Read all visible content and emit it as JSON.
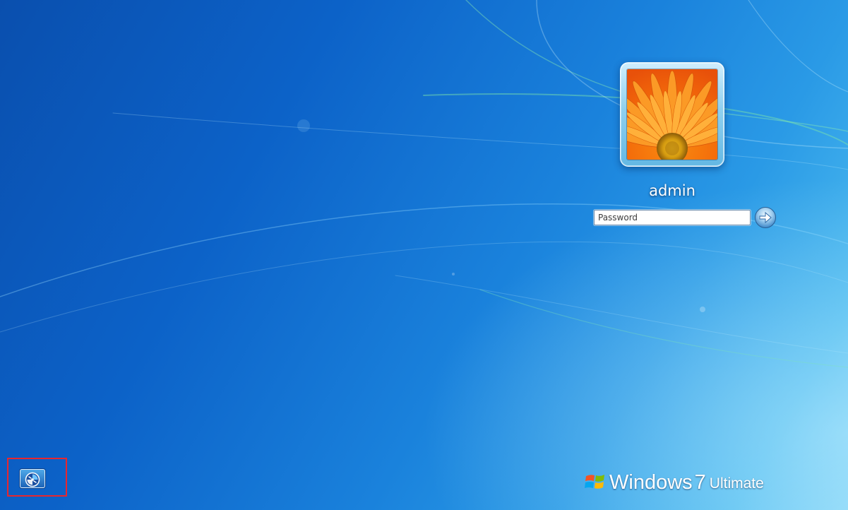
{
  "user": {
    "name": "admin",
    "tile_icon": "flower-picture-icon"
  },
  "login": {
    "password_placeholder": "Password",
    "submit_icon": "arrow-right-icon"
  },
  "ease_of_access": {
    "icon": "ease-of-access-icon"
  },
  "branding": {
    "windows": "Windows",
    "version": "7",
    "edition": "Ultimate",
    "logo_icon": "windows-flag-icon"
  },
  "colors": {
    "background_dark": "#0a4fae",
    "background_light": "#7fd2f6",
    "highlight_border": "#e8262e",
    "flower_orange": "#f57c10"
  }
}
